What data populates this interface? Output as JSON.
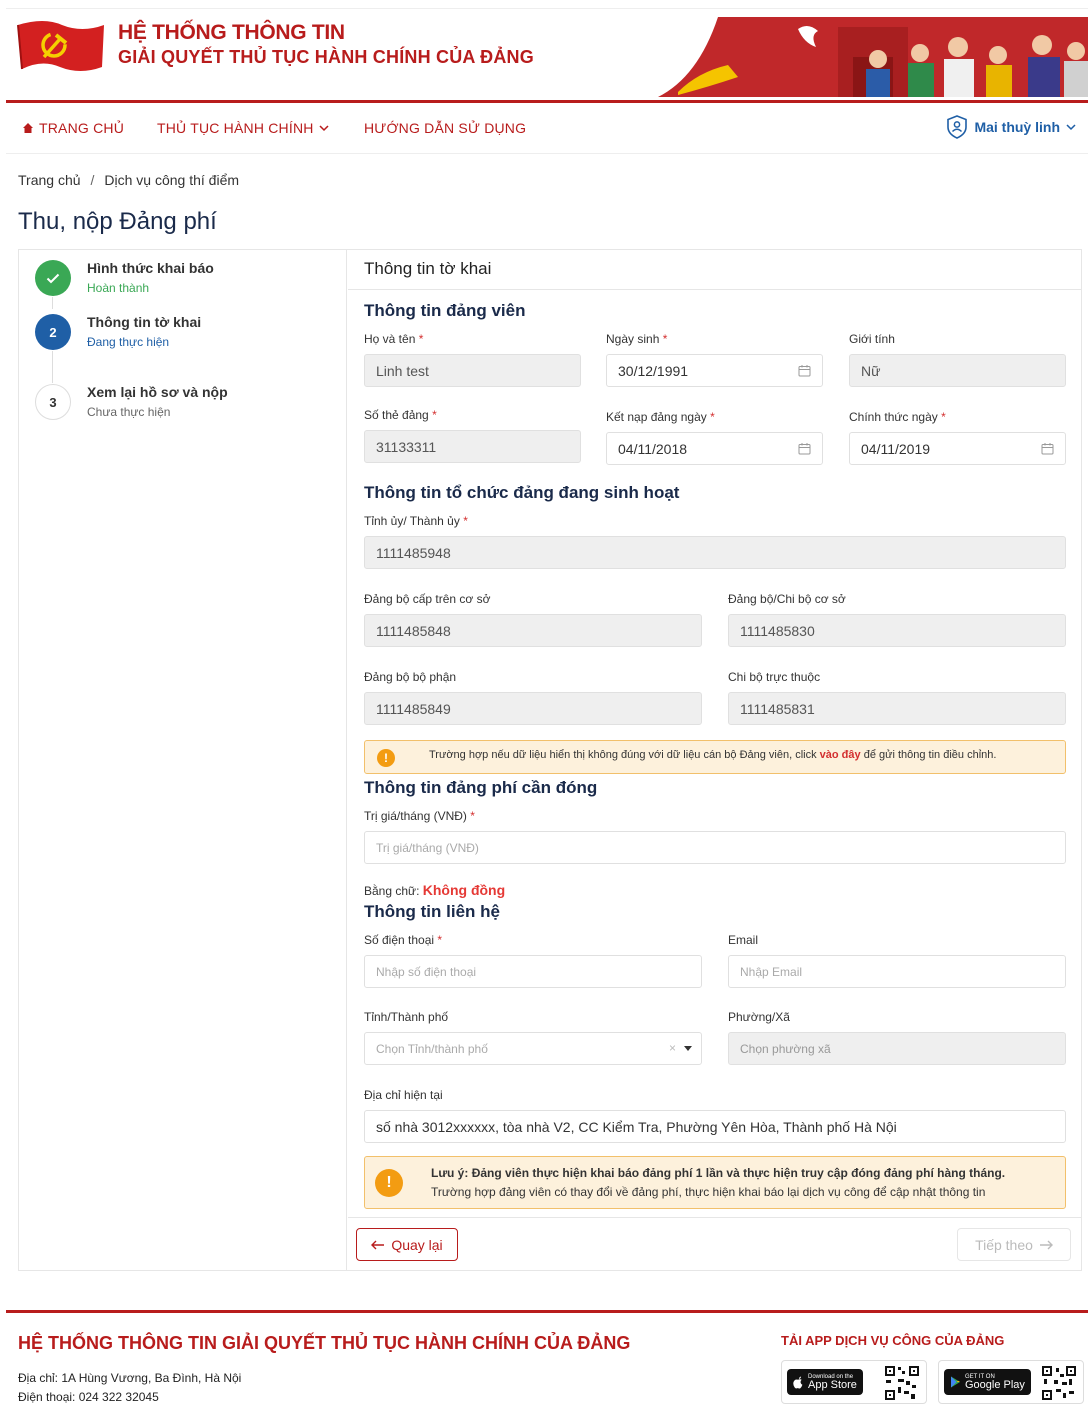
{
  "header": {
    "brand_line1": "HỆ THỐNG THÔNG TIN",
    "brand_line2": "GIẢI QUYẾT THỦ TỤC HÀNH CHÍNH CỦA ĐẢNG",
    "logo_icon": "hammer-sickle-flag-icon",
    "brand_color": "#b81c1c"
  },
  "nav": {
    "home": "TRANG CHỦ",
    "procedures": "THỦ TỤC HÀNH CHÍNH",
    "guide": "HƯỚNG DẪN SỬ DỤNG",
    "user_name": "Mai thuỳ linh"
  },
  "breadcrumb": {
    "home": "Trang chủ",
    "sep": "/",
    "current": "Dịch vụ công thí điểm"
  },
  "page_title": "Thu, nộp Đảng phí",
  "steps": [
    {
      "number": "",
      "title": "Hình thức khai báo",
      "status": "Hoàn thành"
    },
    {
      "number": "2",
      "title": "Thông tin tờ khai",
      "status": "Đang thực hiện"
    },
    {
      "number": "3",
      "title": "Xem lại hồ sơ và nộp",
      "status": "Chưa thực hiện"
    }
  ],
  "form": {
    "heading": "Thông tin tờ khai",
    "member_section": "Thông tin đảng viên",
    "full_name": {
      "label": "Họ và tên",
      "value": "Linh test"
    },
    "dob": {
      "label": "Ngày sinh",
      "value": "30/12/1991"
    },
    "gender": {
      "label": "Giới tính",
      "value": "Nữ"
    },
    "card_no": {
      "label": "Số thẻ đảng",
      "value": "31133311"
    },
    "admission_date": {
      "label": "Kết nạp đảng ngày",
      "value": "04/11/2018"
    },
    "official_date": {
      "label": "Chính thức ngày",
      "value": "04/11/2019"
    },
    "org_section": "Thông tin tổ chức đảng đang sinh hoạt",
    "province_committee": {
      "label": "Tỉnh ủy/ Thành ủy",
      "value": "1111485948"
    },
    "upper_party": {
      "label": "Đảng bộ cấp trên cơ sở",
      "value": "1111485848"
    },
    "base_party": {
      "label": "Đảng bộ/Chi bộ cơ sở",
      "value": "1111485830"
    },
    "division_party": {
      "label": "Đảng bộ bộ phận",
      "value": "1111485849"
    },
    "direct_cell": {
      "label": "Chi bộ trực thuộc",
      "value": "1111485831"
    },
    "org_alert": {
      "before": "Trường hợp nếu dữ liệu hiển thị không đúng với dữ liệu cán bộ Đảng viên, click",
      "link": "vào đây",
      "after": "để gửi thông tin điều chỉnh."
    },
    "fee_section": "Thông tin đảng phí cần đóng",
    "monthly": {
      "label": "Trị giá/tháng (VNĐ)",
      "placeholder": "Trị giá/tháng (VNĐ)"
    },
    "in_words": {
      "label": "Bằng chữ:",
      "value": "Không đồng"
    },
    "contact_section": "Thông tin liên hệ",
    "phone": {
      "label": "Số điện thoại",
      "placeholder": "Nhập số điện thoại"
    },
    "email": {
      "label": "Email",
      "placeholder": "Nhập Email"
    },
    "city": {
      "label": "Tỉnh/Thành phố",
      "placeholder": "Chọn Tỉnh/thành phố",
      "clear": "×"
    },
    "ward": {
      "label": "Phường/Xã",
      "placeholder": "Chọn phường xã"
    },
    "address": {
      "label": "Địa chỉ hiện tại",
      "value": "số nhà 3012xxxxxx, tòa nhà V2, CC Kiểm Tra, Phường Yên Hòa, Thành phố Hà Nội"
    },
    "note_alert": {
      "line1": "Lưu ý: Đảng viên thực hiện khai báo đảng phí 1 lần và thực hiện truy cập đóng đảng phí hàng tháng.",
      "line2": "Trường hợp đảng viên có thay đổi về đảng phí, thực hiện khai báo lại dịch vụ công để cập nhật thông tin"
    },
    "back_button": "Quay lại",
    "next_button": "Tiếp theo"
  },
  "footer": {
    "title": "HỆ THỐNG THÔNG TIN GIẢI QUYẾT THỦ TỤC HÀNH CHÍNH CỦA ĐẢNG",
    "address": "Địa chỉ: 1A Hùng Vương, Ba Đình, Hà Nội",
    "phone": "Điện thoại: 024 322 32045",
    "app_title": "TẢI APP DỊCH VỤ CÔNG CỦA ĐẢNG",
    "app_store_small": "Download on the",
    "app_store": "App Store",
    "google_play_small": "GET IT ON",
    "google_play": "Google Play"
  }
}
